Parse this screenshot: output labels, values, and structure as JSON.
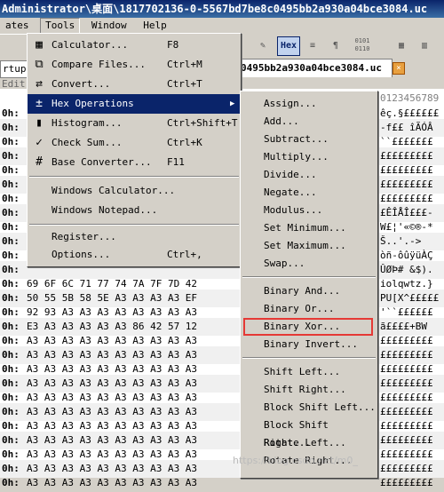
{
  "title": "Administrator\\桌面\\1817702136-0-5567bd7be8c0495bb2a930a04bce3084.uc",
  "menubar": [
    "ates",
    "Tools",
    "Window",
    "Help"
  ],
  "toolbar": {
    "hex_label": "Hex",
    "hex_icon": "hex-view-icon",
    "num_label": "0101\n0110"
  },
  "tabs": {
    "left": "rtup",
    "active": "0495bb2a930a04bce3084.uc",
    "close_icon": "close-icon"
  },
  "edit_label": "Edit",
  "offset_header": "0123456789",
  "tools_menu": {
    "items": [
      {
        "label": "Calculator...",
        "shortcut": "F8",
        "icon": "calculator-icon"
      },
      {
        "label": "Compare Files...",
        "shortcut": "Ctrl+M",
        "icon": "compare-icon"
      },
      {
        "label": "Convert...",
        "shortcut": "Ctrl+T",
        "icon": "convert-icon"
      },
      {
        "label": "Hex Operations",
        "shortcut": "",
        "icon": "hex-ops-icon"
      },
      {
        "label": "Histogram...",
        "shortcut": "Ctrl+Shift+T",
        "icon": "histogram-icon"
      },
      {
        "label": "Check Sum...",
        "shortcut": "Ctrl+K",
        "icon": "checksum-icon"
      },
      {
        "label": "Base Converter...",
        "shortcut": "F11",
        "icon": "base-converter-icon"
      },
      {
        "label": "Windows Calculator...",
        "shortcut": ""
      },
      {
        "label": "Windows Notepad...",
        "shortcut": ""
      },
      {
        "label": "Register...",
        "shortcut": ""
      },
      {
        "label": "Options...",
        "shortcut": "Ctrl+,"
      }
    ]
  },
  "hex_ops_menu": [
    "Assign...",
    "Add...",
    "Subtract...",
    "Multiply...",
    "Divide...",
    "Negate...",
    "Modulus...",
    "Set Minimum...",
    "Set Maximum...",
    "Swap...",
    "Binary And...",
    "Binary Or...",
    "Binary Xor...",
    "Binary Invert...",
    "Shift Left...",
    "Shift Right...",
    "Block Shift Left...",
    "Block Shift Right...",
    "Rotate Left...",
    "Rotate Right..."
  ],
  "rows": [
    {
      "off": "0h:",
      "bytes": "",
      "ascii": "êç.§££££££"
    },
    {
      "off": "0h:",
      "bytes": "",
      "ascii": "-f££ îÃÓÂ"
    },
    {
      "off": "0h:",
      "bytes": "",
      "ascii": "``£££££££"
    },
    {
      "off": "0h:",
      "bytes": "",
      "ascii": "£££££££££"
    },
    {
      "off": "0h:",
      "bytes": "",
      "ascii": "£££££££££"
    },
    {
      "off": "0h:",
      "bytes": "",
      "ascii": "£££££££££"
    },
    {
      "off": "0h:",
      "bytes": "",
      "ascii": "£££££££££"
    },
    {
      "off": "0h:",
      "bytes": "",
      "ascii": "£ÊÎÅÎ£££-"
    },
    {
      "off": "0h:",
      "bytes": "",
      "ascii": "W£¦'«©®-*"
    },
    {
      "off": "0h:",
      "bytes": "",
      "ascii": "Š..'.->"
    },
    {
      "off": "0h:",
      "bytes": "",
      "ascii": "òñ-ôûÿüÀÇ"
    },
    {
      "off": "0h:",
      "bytes": "",
      "ascii": "ÛØÞ# &$)."
    },
    {
      "off": "0h:",
      "bytes": "69 6F 6C 71 77 74 7A 7F 7D 42",
      "ascii": "iolqwtz.}"
    },
    {
      "off": "0h:",
      "bytes": "50 55 5B 58 5E A3 A3 A3 A3 EF",
      "ascii": "PU[X^£££££"
    },
    {
      "off": "0h:",
      "bytes": "92 93 A3 A3 A3 A3 A3 A3 A3 A3",
      "ascii": "'``££££££"
    },
    {
      "off": "0h:",
      "bytes": "E3 A3 A3 A3 A3 A3 86 42 57 12",
      "ascii": "ã££££+BW"
    },
    {
      "off": "0h:",
      "bytes": "A3 A3 A3 A3 A3 A3 A3 A3 A3 A3",
      "ascii": "£££££££££"
    },
    {
      "off": "0h:",
      "bytes": "A3 A3 A3 A3 A3 A3 A3 A3 A3 A3",
      "ascii": "£££££££££"
    },
    {
      "off": "0h:",
      "bytes": "A3 A3 A3 A3 A3 A3 A3 A3 A3 A3",
      "ascii": "£££££££££"
    },
    {
      "off": "0h:",
      "bytes": "A3 A3 A3 A3 A3 A3 A3 A3 A3 A3",
      "ascii": "£££££££££"
    },
    {
      "off": "0h:",
      "bytes": "A3 A3 A3 A3 A3 A3 A3 A3 A3 A3",
      "ascii": "£££££££££"
    },
    {
      "off": "0h:",
      "bytes": "A3 A3 A3 A3 A3 A3 A3 A3 A3 A3",
      "ascii": "£££££££££"
    },
    {
      "off": "0h:",
      "bytes": "A3 A3 A3 A3 A3 A3 A3 A3 A3 A3",
      "ascii": "£££££££££"
    },
    {
      "off": "0h:",
      "bytes": "A3 A3 A3 A3 A3 A3 A3 A3 A3 A3",
      "ascii": "£££££££££"
    },
    {
      "off": "0h:",
      "bytes": "A3 A3 A3 A3 A3 A3 A3 A3 A3 A3",
      "ascii": "£££££££££"
    },
    {
      "off": "0h:",
      "bytes": "A3 A3 A3 A3 A3 A3 A3 A3 A3 A3",
      "ascii": "£££££££££"
    },
    {
      "off": "0h:",
      "bytes": "A3 A3 A3 A3 A3 A3 A3 A3 A3 A3",
      "ascii": "£££££££££"
    }
  ],
  "watermark": "https://blog.csdn.net/m0_"
}
